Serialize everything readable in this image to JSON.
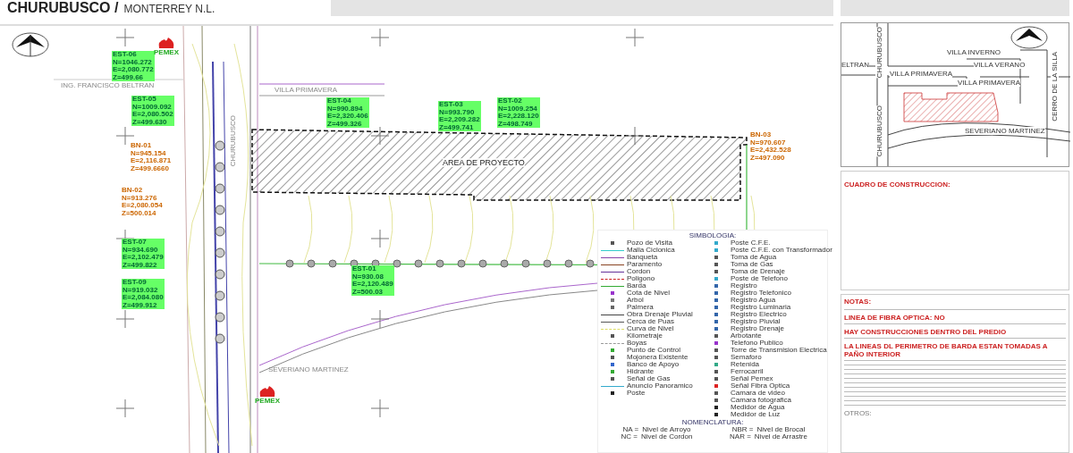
{
  "header": {
    "title": "CHURUBUSCO /",
    "subtitle": "MONTERREY N.L."
  },
  "plan": {
    "streets": [
      "ING. FRANCISCO BELTRAN",
      "VILLA PRIMAVERA",
      "CHURUBUSCO",
      "SEVERIANO MARTINEZ"
    ],
    "area_label": "AREA DE PROYECTO",
    "logos": [
      "PEMEX",
      "PEMEX"
    ],
    "stations": [
      {
        "kind": "est",
        "name": "EST-06",
        "lines": [
          "N=1046.272",
          "E=2,080.772",
          "Z=499.66"
        ]
      },
      {
        "kind": "est",
        "name": "EST-05",
        "lines": [
          "N=1009.092",
          "E=2,080.502",
          "Z=499.630"
        ]
      },
      {
        "kind": "est",
        "name": "EST-04",
        "lines": [
          "N=990.894",
          "E=2,320.406",
          "Z=499.326"
        ]
      },
      {
        "kind": "est",
        "name": "EST-03",
        "lines": [
          "N=993.790",
          "E=2,209.282",
          "Z=499.741"
        ]
      },
      {
        "kind": "est",
        "name": "EST-02",
        "lines": [
          "N=1009.254",
          "E=2,228.120",
          "Z=498.749"
        ]
      },
      {
        "kind": "bn",
        "name": "BN-01",
        "lines": [
          "N=945.154",
          "E=2,116.871",
          "Z=499.6660"
        ]
      },
      {
        "kind": "bn",
        "name": "BN-02",
        "lines": [
          "N=913.276",
          "E=2,080.054",
          "Z=500.014"
        ]
      },
      {
        "kind": "est",
        "name": "EST-07",
        "lines": [
          "N=934.690",
          "E=2,102.479",
          "Z=499.822"
        ]
      },
      {
        "kind": "est",
        "name": "EST-09",
        "lines": [
          "N=919.032",
          "E=2,084.080",
          "Z=499.912"
        ]
      },
      {
        "kind": "est",
        "name": "EST-01",
        "lines": [
          "N=930.08",
          "E=2,120.489",
          "Z=500.03"
        ]
      },
      {
        "kind": "bn",
        "name": "BN-03",
        "lines": [
          "N=970.607",
          "E=2,432.528",
          "Z=497.090"
        ]
      }
    ]
  },
  "legend": {
    "title": "SIMBOLOGIA:",
    "left": [
      {
        "label": "Pozo de Visita",
        "kind": "mark",
        "color": "#555555"
      },
      {
        "label": "Malla Ciclonica",
        "kind": "line",
        "color": "#33cccc"
      },
      {
        "label": "Banqueta",
        "kind": "line",
        "color": "#8844aa"
      },
      {
        "label": "Paramento",
        "kind": "line",
        "color": "#884422"
      },
      {
        "label": "Cordon",
        "kind": "line",
        "color": "#663399"
      },
      {
        "label": "Poligono",
        "kind": "dashed",
        "color": "#cc2222"
      },
      {
        "label": "Barda",
        "kind": "line",
        "color": "#33aa33"
      },
      {
        "label": "Cota de Nivel",
        "kind": "mark",
        "color": "#9933cc"
      },
      {
        "label": "Arbol",
        "kind": "mark",
        "color": "#777777"
      },
      {
        "label": "Palmera",
        "kind": "mark",
        "color": "#666666"
      },
      {
        "label": "Obra Drenaje Pluvial",
        "kind": "line",
        "color": "#444444"
      },
      {
        "label": "Cerca de Puas",
        "kind": "line",
        "color": "#555555"
      },
      {
        "label": "Curva de Nivel",
        "kind": "dashed",
        "color": "#dddd66"
      },
      {
        "label": "Kilometraje",
        "kind": "mark",
        "color": "#555555"
      },
      {
        "label": "Boyas",
        "kind": "dashed",
        "color": "#999999"
      },
      {
        "label": "Punto de Control",
        "kind": "mark",
        "color": "#33aa33"
      },
      {
        "label": "Mojonera Existente",
        "kind": "mark",
        "color": "#555555"
      },
      {
        "label": "Banco de Apoyo",
        "kind": "mark",
        "color": "#3366cc"
      },
      {
        "label": "Hidrante",
        "kind": "mark",
        "color": "#33aa33"
      },
      {
        "label": "Señal de Gas",
        "kind": "mark",
        "color": "#555555"
      },
      {
        "label": "Anuncio Panoramico",
        "kind": "line",
        "color": "#33aacc"
      },
      {
        "label": "Poste",
        "kind": "mark",
        "color": "#222222"
      }
    ],
    "right": [
      {
        "label": "Poste C.F.E.",
        "color": "#33aacc"
      },
      {
        "label": "Poste C.F.E. con Transformador",
        "color": "#33aacc"
      },
      {
        "label": "Toma de Agua",
        "color": "#555555"
      },
      {
        "label": "Toma de Gas",
        "color": "#555555"
      },
      {
        "label": "Toma de Drenaje",
        "color": "#555555"
      },
      {
        "label": "Poste de Telefono",
        "color": "#33aacc"
      },
      {
        "label": "Registro",
        "color": "#3366aa"
      },
      {
        "label": "Registro Telefonico",
        "color": "#3366aa"
      },
      {
        "label": "Registro Agua",
        "color": "#3366aa"
      },
      {
        "label": "Registro Luminaria",
        "color": "#3366aa"
      },
      {
        "label": "Registro Electrico",
        "color": "#3366aa"
      },
      {
        "label": "Registro Pluvial",
        "color": "#3366aa"
      },
      {
        "label": "Registro Drenaje",
        "color": "#3366aa"
      },
      {
        "label": "Arbotante",
        "color": "#555555"
      },
      {
        "label": "Telefono Publico",
        "color": "#9933cc"
      },
      {
        "label": "Torre de Transmision Electrica",
        "color": "#555555"
      },
      {
        "label": "Semaforo",
        "color": "#555555"
      },
      {
        "label": "Retenida",
        "color": "#33aa88"
      },
      {
        "label": "Ferrocarril",
        "color": "#555555"
      },
      {
        "label": "Señal Pemex",
        "color": "#555555"
      },
      {
        "label": "Señal Fibra Optica",
        "color": "#dd2222"
      },
      {
        "label": "Camara de video",
        "color": "#555555"
      },
      {
        "label": "Camara fotografica",
        "color": "#555555"
      },
      {
        "label": "Medidor de Agua",
        "color": "#222222"
      },
      {
        "label": "Medidor de Luz",
        "color": "#222222"
      }
    ],
    "nomenclature_title": "NOMENCLATURA:",
    "nomenclature": [
      {
        "code": "NA =",
        "text": "Nivel de Arroyo"
      },
      {
        "code": "NBR =",
        "text": "Nivel de Brocal"
      },
      {
        "code": "NC =",
        "text": "Nivel de Cordon"
      },
      {
        "code": "NAR =",
        "text": "Nivel de Arrastre"
      }
    ]
  },
  "location_map": {
    "labels": [
      "CHURUBUSCO",
      "VILLA INVERNO",
      "CERRO DE LA SILLA",
      "ELTRAN",
      "VILLA VERANO",
      "VILLA PRIMAVERA",
      "VILLA PRIMAVERA",
      "CHURUBUSCO",
      "SEVERIANO MARTINEZ"
    ]
  },
  "construction_box": {
    "title": "CUADRO DE CONSTRUCCION:"
  },
  "notes": {
    "title": "NOTAS:",
    "items": [
      "LINEA DE FIBRA OPTICA: NO",
      "HAY CONSTRUCCIONES DENTRO DEL PREDIO",
      "**LA LINEAS DL PERIMETRO DE BARDA ESTAN TOMADAS A PA**ÑO INTERIOR"
    ],
    "footer": "OTROS:"
  }
}
